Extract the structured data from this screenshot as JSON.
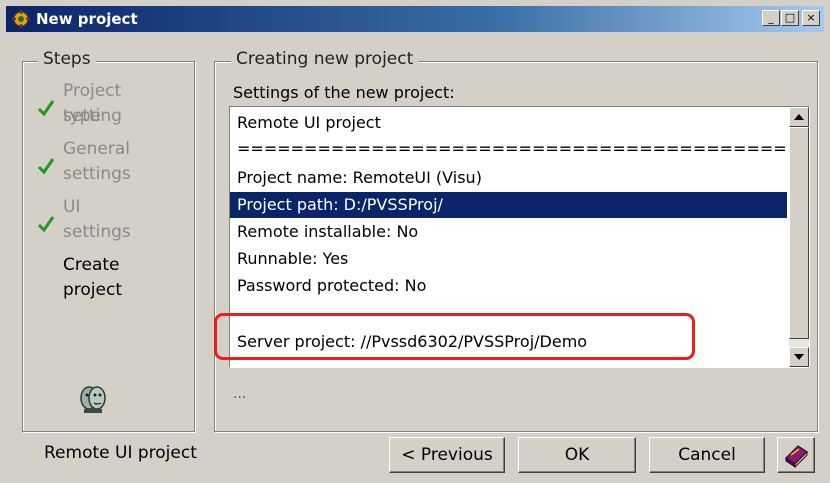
{
  "window": {
    "title": "New project",
    "minimize_glyph": "_",
    "maximize_glyph": "□",
    "close_glyph": "×"
  },
  "steps_panel": {
    "title": "Steps",
    "items": [
      {
        "line1": "Project type",
        "line2": "setting",
        "done": true
      },
      {
        "line1": "General",
        "line2": "settings",
        "done": true
      },
      {
        "line1": "UI",
        "line2": "settings",
        "done": true
      },
      {
        "line1": "Create",
        "line2": "project",
        "done": false
      }
    ],
    "footer_icon": "faces-icon"
  },
  "main_panel": {
    "title": "Creating new project",
    "settings_label": "Settings of the new project:",
    "rows": [
      "Remote UI project",
      "=============================================",
      "Project name: RemoteUI (Visu)",
      "Project path: D:/PVSSProj/",
      "Remote installable: No",
      "Runnable: Yes",
      "Password protected: No",
      "",
      "Server project: //Pvssd6302/PVSSProj/Demo"
    ],
    "selected_row_index": 3,
    "below_text": "..."
  },
  "status": {
    "text": "Remote UI project"
  },
  "buttons": {
    "previous": "< Previous",
    "ok": "OK",
    "cancel": "Cancel",
    "help_icon": "book-icon"
  },
  "colors": {
    "window_bg": "#d4d0c8",
    "title_bar": "#0a246a",
    "selection": "#0a246a",
    "check": "#1f9a1f",
    "highlight_frame": "#e8201a"
  }
}
